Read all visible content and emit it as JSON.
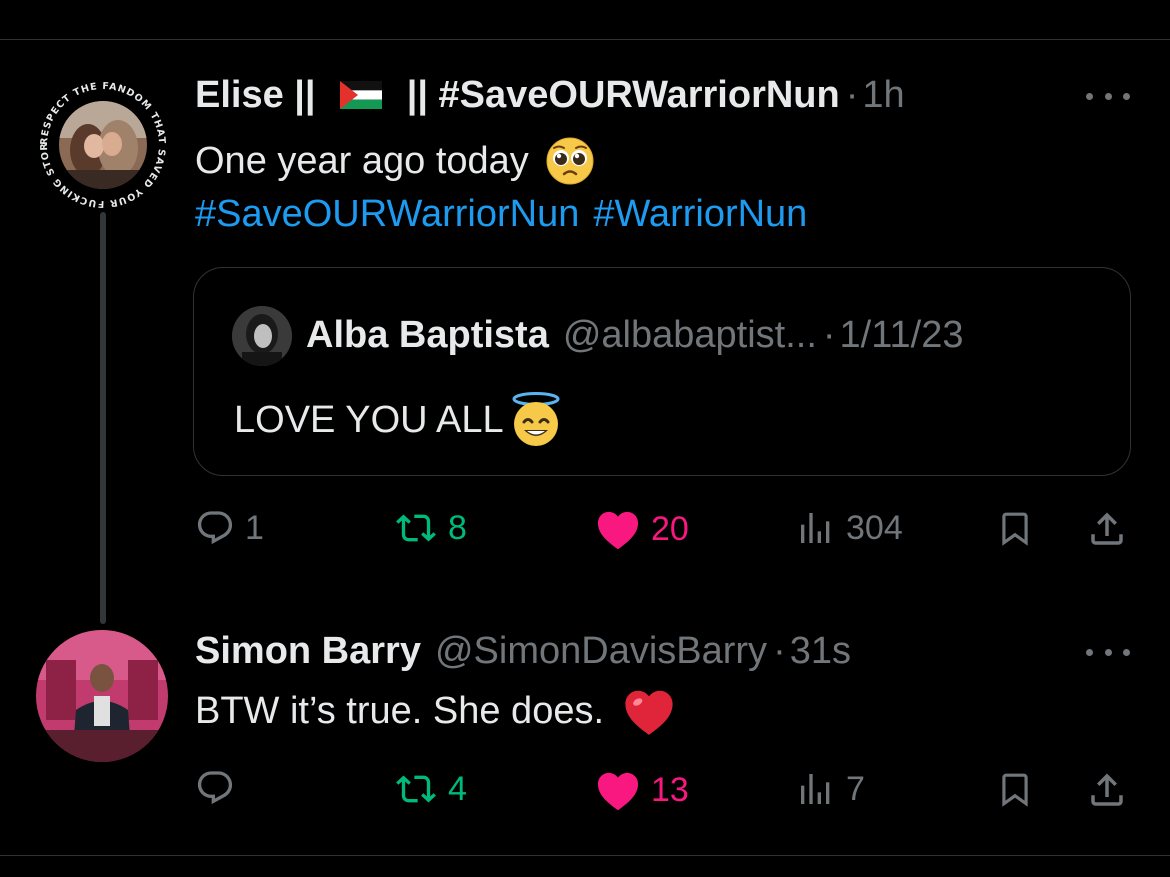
{
  "tweet1": {
    "display_name_prefix": "Elise ||",
    "display_name_suffix": "|| #SaveOURWarriorNun",
    "time": "1h",
    "text": "One year ago today",
    "hashtags": [
      "#SaveOURWarriorNun",
      "#WarriorNun"
    ],
    "avatar_ring_text": "RESPECT THE FANDOM THAT SAVED YOUR FUCKING STORY",
    "quote": {
      "name": "Alba Baptista",
      "handle": "@albabaptist...",
      "date": "1/11/23",
      "text": "LOVE YOU ALL"
    },
    "actions": {
      "replies": "1",
      "retweets": "8",
      "likes": "20",
      "views": "304"
    }
  },
  "tweet2": {
    "display_name": "Simon Barry",
    "handle": "@SimonDavisBarry",
    "time": "31s",
    "text": "BTW it’s true. She does.",
    "actions": {
      "replies": "",
      "retweets": "4",
      "likes": "13",
      "views": "7"
    }
  },
  "separator": "·",
  "colors": {
    "background": "#000000",
    "text": "#e7e9ea",
    "muted": "#71767b",
    "link": "#1d9bf0",
    "retweet": "#00ba7c",
    "like": "#f91880",
    "border": "#2f3336"
  }
}
